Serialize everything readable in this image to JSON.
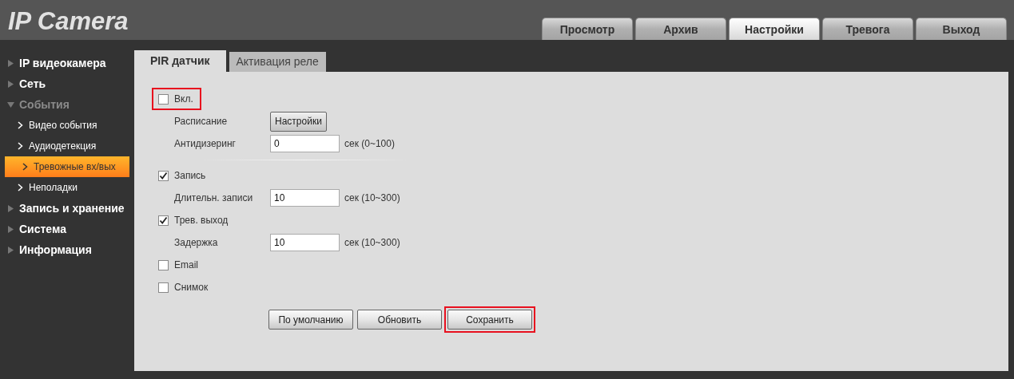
{
  "logo": "IP Camera",
  "top_tabs": [
    {
      "label": "Просмотр",
      "selected": false
    },
    {
      "label": "Архив",
      "selected": false
    },
    {
      "label": "Настройки",
      "selected": true
    },
    {
      "label": "Тревога",
      "selected": false
    },
    {
      "label": "Выход",
      "selected": false
    }
  ],
  "sidebar": {
    "items": [
      {
        "label": "IP видеокамера",
        "expanded": false
      },
      {
        "label": "Сеть",
        "expanded": false
      },
      {
        "label": "События",
        "expanded": true,
        "children": [
          {
            "label": "Видео события",
            "selected": false
          },
          {
            "label": "Аудиодетекция",
            "selected": false
          },
          {
            "label": "Тревожные вх/вых",
            "selected": true
          },
          {
            "label": "Неполадки",
            "selected": false
          }
        ]
      },
      {
        "label": "Запись и хранение",
        "expanded": false
      },
      {
        "label": "Система",
        "expanded": false
      },
      {
        "label": "Информация",
        "expanded": false
      }
    ]
  },
  "tabs": [
    {
      "label": "PIR датчик",
      "selected": true
    },
    {
      "label": "Активация реле",
      "selected": false
    }
  ],
  "form": [
    {
      "kind": "checkbox",
      "label": "Вкл.",
      "checked": false,
      "highlighted": true
    },
    {
      "kind": "button_field",
      "label": "Расписание",
      "button": "Настройки"
    },
    {
      "kind": "field",
      "label": "Антидизеринг",
      "value": "0",
      "unit": "сек (0~100)"
    },
    {
      "kind": "divider"
    },
    {
      "kind": "checkbox",
      "label": "Запись",
      "checked": true,
      "highlighted": false
    },
    {
      "kind": "field",
      "label": "Длительн. записи",
      "value": "10",
      "unit": "сек (10~300)"
    },
    {
      "kind": "checkbox",
      "label": "Трев. выход",
      "checked": true,
      "highlighted": false
    },
    {
      "kind": "field",
      "label": "Задержка",
      "value": "10",
      "unit": "сек (10~300)"
    },
    {
      "kind": "checkbox",
      "label": "Email",
      "checked": false,
      "highlighted": false
    },
    {
      "kind": "checkbox",
      "label": "Снимок",
      "checked": false,
      "highlighted": false
    }
  ],
  "buttons": [
    {
      "label": "По умолчанию",
      "highlighted": false
    },
    {
      "label": "Обновить",
      "highlighted": false
    },
    {
      "label": "Сохранить",
      "highlighted": true
    }
  ]
}
